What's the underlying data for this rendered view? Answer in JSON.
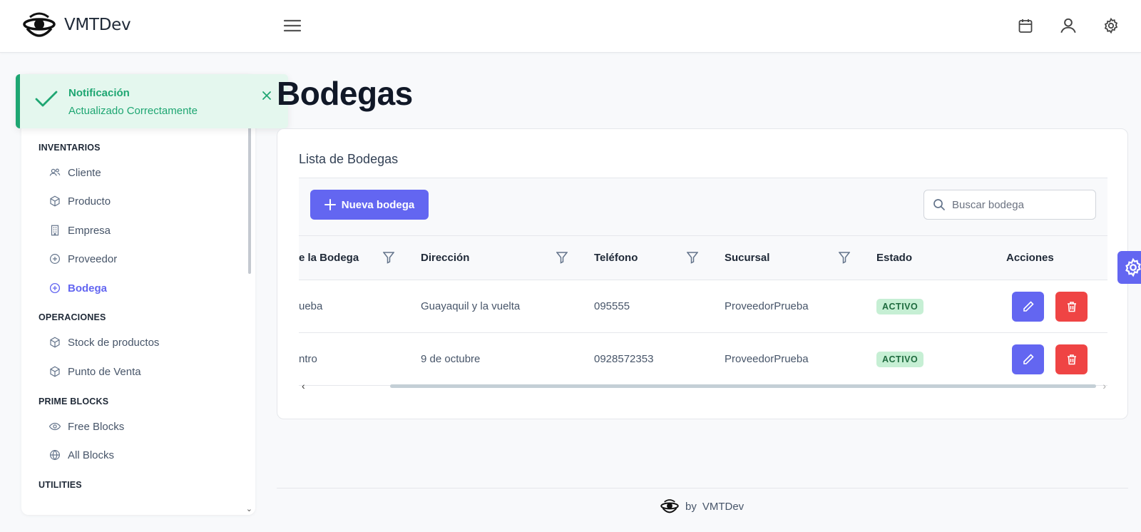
{
  "app": {
    "brand": "VMTDev"
  },
  "notification": {
    "title": "Notificación",
    "message": "Actualizado Correctamente"
  },
  "sidebar": {
    "sections": [
      {
        "label": "INVENTARIOS"
      },
      {
        "label": "OPERACIONES"
      },
      {
        "label": "PRIME BLOCKS"
      },
      {
        "label": "UTILITIES"
      }
    ],
    "items": [
      {
        "label": "Cliente",
        "icon": "users-icon"
      },
      {
        "label": "Producto",
        "icon": "box-icon"
      },
      {
        "label": "Empresa",
        "icon": "building-icon"
      },
      {
        "label": "Proveedor",
        "icon": "plus-circle-icon"
      },
      {
        "label": "Bodega",
        "icon": "plus-circle-icon",
        "active": true
      },
      {
        "label": "Stock de productos",
        "icon": "box-icon"
      },
      {
        "label": "Punto de Venta",
        "icon": "box-icon"
      },
      {
        "label": "Free Blocks",
        "icon": "eye-icon"
      },
      {
        "label": "All Blocks",
        "icon": "globe-icon"
      }
    ]
  },
  "page": {
    "title": "Bodegas",
    "card_title": "Lista de Bodegas",
    "new_button": "Nueva bodega",
    "search_placeholder": "Buscar bodega"
  },
  "table": {
    "columns": [
      "e la Bodega",
      "Dirección",
      "Teléfono",
      "Sucursal",
      "Estado",
      "Acciones"
    ],
    "rows": [
      {
        "nombre": "ueba",
        "direccion": "Guayaquil y la vuelta",
        "telefono": "095555",
        "sucursal": "ProveedorPrueba",
        "estado": "ACTIVO"
      },
      {
        "nombre": "ntro",
        "direccion": "9 de octubre",
        "telefono": "0928572353",
        "sucursal": "ProveedorPrueba",
        "estado": "ACTIVO"
      }
    ]
  },
  "footer": {
    "by": "by",
    "brand": "VMTDev"
  },
  "colors": {
    "primary": "#6366f1",
    "danger": "#ef4444",
    "success": "#1ea672",
    "badge_bg": "#c6efd4"
  }
}
